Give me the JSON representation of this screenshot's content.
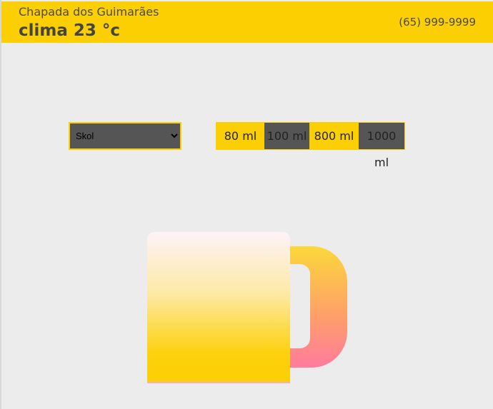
{
  "header": {
    "location": "Chapada dos Guimarães",
    "weather": "clima 23 °c",
    "phone": "(65) 999-9999"
  },
  "beer_select": {
    "selected": "Skol",
    "options": [
      "Skol"
    ]
  },
  "sizes": [
    {
      "label": "80 ml",
      "style": "yellow"
    },
    {
      "label": "100 ml",
      "style": "dark"
    },
    {
      "label": "800 ml",
      "style": "yellow"
    },
    {
      "label": "1000 ml",
      "style": "dark"
    }
  ],
  "colors": {
    "accent": "#fccf03",
    "dark": "#555555",
    "background": "#ececec",
    "handle_gradient_end": "#ff7b9c"
  }
}
